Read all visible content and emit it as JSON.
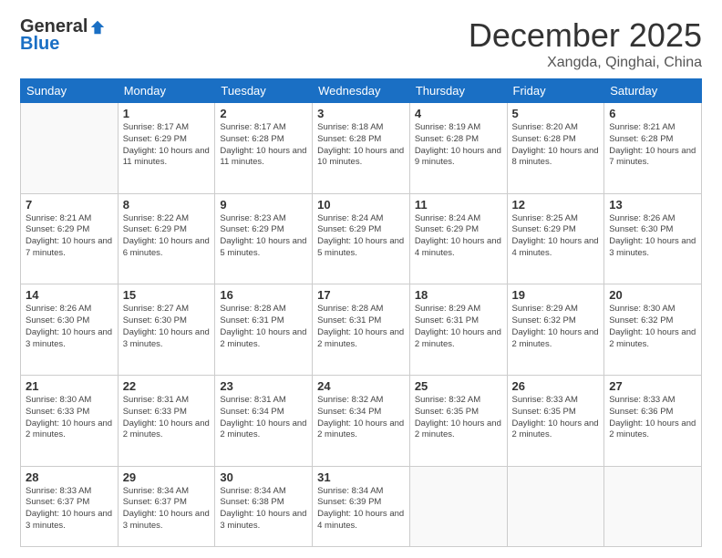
{
  "logo": {
    "general": "General",
    "blue": "Blue"
  },
  "title": "December 2025",
  "location": "Xangda, Qinghai, China",
  "days_of_week": [
    "Sunday",
    "Monday",
    "Tuesday",
    "Wednesday",
    "Thursday",
    "Friday",
    "Saturday"
  ],
  "weeks": [
    [
      {
        "day": null
      },
      {
        "day": "1",
        "sunrise": "8:17 AM",
        "sunset": "6:29 PM",
        "daylight": "10 hours and 11 minutes."
      },
      {
        "day": "2",
        "sunrise": "8:17 AM",
        "sunset": "6:28 PM",
        "daylight": "10 hours and 11 minutes."
      },
      {
        "day": "3",
        "sunrise": "8:18 AM",
        "sunset": "6:28 PM",
        "daylight": "10 hours and 10 minutes."
      },
      {
        "day": "4",
        "sunrise": "8:19 AM",
        "sunset": "6:28 PM",
        "daylight": "10 hours and 9 minutes."
      },
      {
        "day": "5",
        "sunrise": "8:20 AM",
        "sunset": "6:28 PM",
        "daylight": "10 hours and 8 minutes."
      },
      {
        "day": "6",
        "sunrise": "8:21 AM",
        "sunset": "6:28 PM",
        "daylight": "10 hours and 7 minutes."
      }
    ],
    [
      {
        "day": "7",
        "sunrise": "8:21 AM",
        "sunset": "6:29 PM",
        "daylight": "10 hours and 7 minutes."
      },
      {
        "day": "8",
        "sunrise": "8:22 AM",
        "sunset": "6:29 PM",
        "daylight": "10 hours and 6 minutes."
      },
      {
        "day": "9",
        "sunrise": "8:23 AM",
        "sunset": "6:29 PM",
        "daylight": "10 hours and 5 minutes."
      },
      {
        "day": "10",
        "sunrise": "8:24 AM",
        "sunset": "6:29 PM",
        "daylight": "10 hours and 5 minutes."
      },
      {
        "day": "11",
        "sunrise": "8:24 AM",
        "sunset": "6:29 PM",
        "daylight": "10 hours and 4 minutes."
      },
      {
        "day": "12",
        "sunrise": "8:25 AM",
        "sunset": "6:29 PM",
        "daylight": "10 hours and 4 minutes."
      },
      {
        "day": "13",
        "sunrise": "8:26 AM",
        "sunset": "6:30 PM",
        "daylight": "10 hours and 3 minutes."
      }
    ],
    [
      {
        "day": "14",
        "sunrise": "8:26 AM",
        "sunset": "6:30 PM",
        "daylight": "10 hours and 3 minutes."
      },
      {
        "day": "15",
        "sunrise": "8:27 AM",
        "sunset": "6:30 PM",
        "daylight": "10 hours and 3 minutes."
      },
      {
        "day": "16",
        "sunrise": "8:28 AM",
        "sunset": "6:31 PM",
        "daylight": "10 hours and 2 minutes."
      },
      {
        "day": "17",
        "sunrise": "8:28 AM",
        "sunset": "6:31 PM",
        "daylight": "10 hours and 2 minutes."
      },
      {
        "day": "18",
        "sunrise": "8:29 AM",
        "sunset": "6:31 PM",
        "daylight": "10 hours and 2 minutes."
      },
      {
        "day": "19",
        "sunrise": "8:29 AM",
        "sunset": "6:32 PM",
        "daylight": "10 hours and 2 minutes."
      },
      {
        "day": "20",
        "sunrise": "8:30 AM",
        "sunset": "6:32 PM",
        "daylight": "10 hours and 2 minutes."
      }
    ],
    [
      {
        "day": "21",
        "sunrise": "8:30 AM",
        "sunset": "6:33 PM",
        "daylight": "10 hours and 2 minutes."
      },
      {
        "day": "22",
        "sunrise": "8:31 AM",
        "sunset": "6:33 PM",
        "daylight": "10 hours and 2 minutes."
      },
      {
        "day": "23",
        "sunrise": "8:31 AM",
        "sunset": "6:34 PM",
        "daylight": "10 hours and 2 minutes."
      },
      {
        "day": "24",
        "sunrise": "8:32 AM",
        "sunset": "6:34 PM",
        "daylight": "10 hours and 2 minutes."
      },
      {
        "day": "25",
        "sunrise": "8:32 AM",
        "sunset": "6:35 PM",
        "daylight": "10 hours and 2 minutes."
      },
      {
        "day": "26",
        "sunrise": "8:33 AM",
        "sunset": "6:35 PM",
        "daylight": "10 hours and 2 minutes."
      },
      {
        "day": "27",
        "sunrise": "8:33 AM",
        "sunset": "6:36 PM",
        "daylight": "10 hours and 2 minutes."
      }
    ],
    [
      {
        "day": "28",
        "sunrise": "8:33 AM",
        "sunset": "6:37 PM",
        "daylight": "10 hours and 3 minutes."
      },
      {
        "day": "29",
        "sunrise": "8:34 AM",
        "sunset": "6:37 PM",
        "daylight": "10 hours and 3 minutes."
      },
      {
        "day": "30",
        "sunrise": "8:34 AM",
        "sunset": "6:38 PM",
        "daylight": "10 hours and 3 minutes."
      },
      {
        "day": "31",
        "sunrise": "8:34 AM",
        "sunset": "6:39 PM",
        "daylight": "10 hours and 4 minutes."
      },
      {
        "day": null
      },
      {
        "day": null
      },
      {
        "day": null
      }
    ]
  ],
  "labels": {
    "sunrise": "Sunrise:",
    "sunset": "Sunset:",
    "daylight": "Daylight:"
  }
}
